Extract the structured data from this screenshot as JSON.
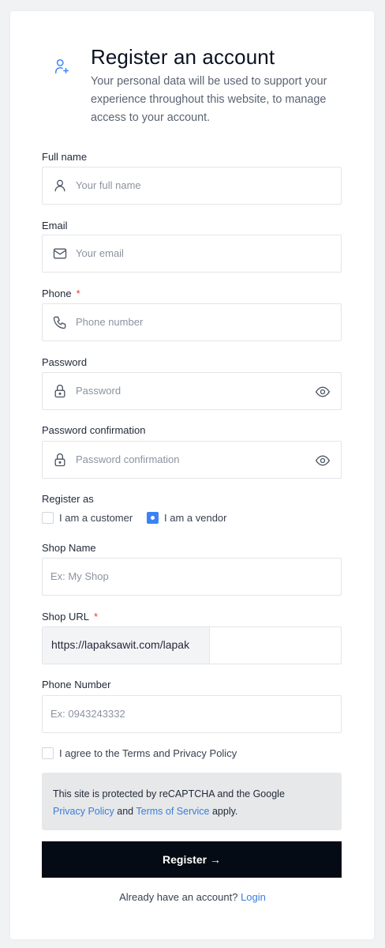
{
  "header": {
    "title": "Register an account",
    "subtitle": "Your personal data will be used to support your experience throughout this website, to manage access to your account.",
    "icon": "user-plus-icon"
  },
  "fields": {
    "full_name": {
      "label": "Full name",
      "placeholder": "Your full name",
      "icon": "user-icon"
    },
    "email": {
      "label": "Email",
      "placeholder": "Your email",
      "icon": "mail-icon"
    },
    "phone": {
      "label": "Phone",
      "required": "*",
      "placeholder": "Phone number",
      "icon": "phone-icon"
    },
    "password": {
      "label": "Password",
      "placeholder": "Password",
      "icon": "lock-icon",
      "toggle_icon": "eye-icon"
    },
    "password_confirmation": {
      "label": "Password confirmation",
      "placeholder": "Password confirmation",
      "icon": "lock-icon",
      "toggle_icon": "eye-icon"
    }
  },
  "register_as": {
    "label": "Register as",
    "options": [
      {
        "label": "I am a customer",
        "selected": false
      },
      {
        "label": "I am a vendor",
        "selected": true
      }
    ]
  },
  "shop": {
    "name_label": "Shop Name",
    "name_placeholder": "Ex: My Shop",
    "url_label": "Shop URL",
    "url_required": "*",
    "url_prefix": "https://lapaksawit.com/lapak",
    "url_value": "",
    "phone_label": "Phone Number",
    "phone_placeholder": "Ex: 0943243332"
  },
  "agree": {
    "label": "I agree to the Terms and Privacy Policy",
    "checked": false
  },
  "captcha": {
    "text_before": "This site is protected by reCAPTCHA and the Google",
    "privacy_link": "Privacy Policy",
    "and": "and",
    "terms_link": "Terms of Service",
    "apply": "apply."
  },
  "submit": {
    "label": "Register →"
  },
  "footer": {
    "text": "Already have an account?",
    "login_link": "Login"
  },
  "colors": {
    "accent": "#3b82f6",
    "link": "#3b7dd8",
    "button": "#050b14",
    "required": "#e53935",
    "background": "#f1f2f4"
  }
}
